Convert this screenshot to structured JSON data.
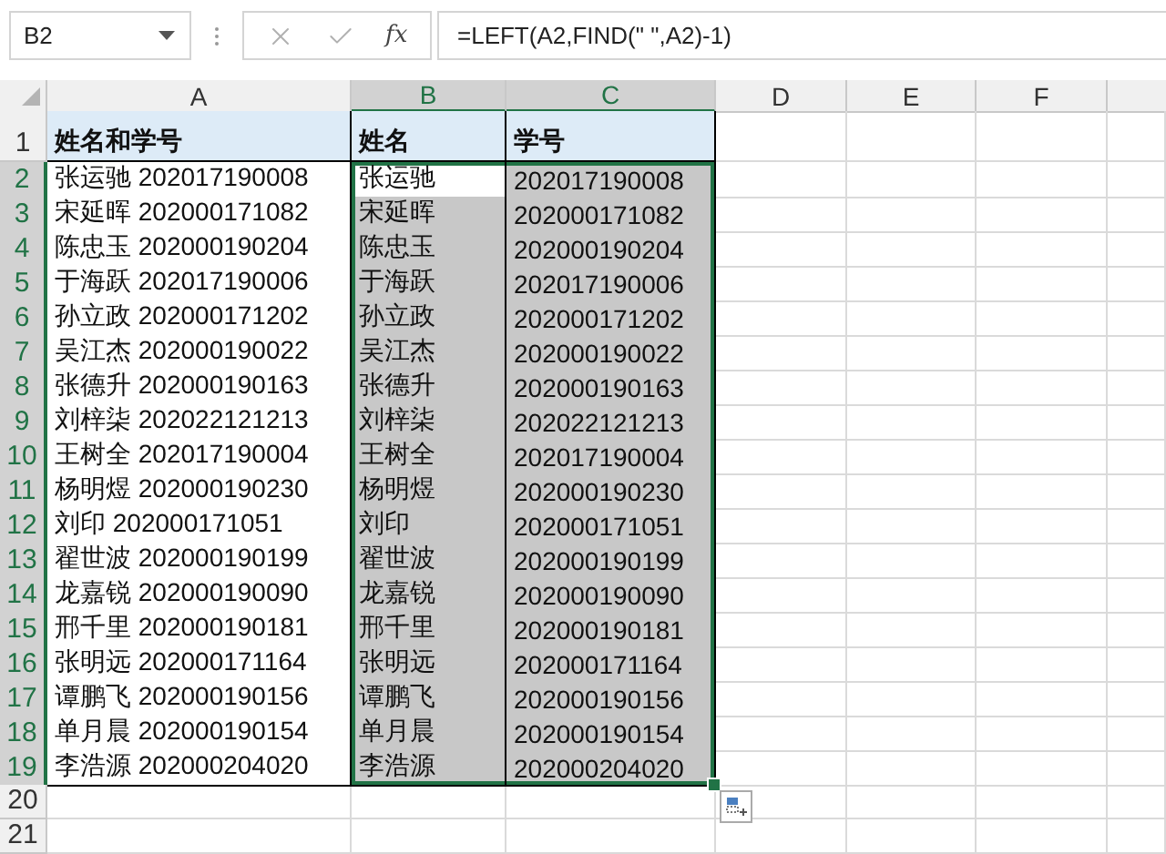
{
  "formula_bar": {
    "name_box": "B2",
    "fx": "fx",
    "formula": "=LEFT(A2,FIND(\" \",A2)-1)"
  },
  "columns": [
    {
      "label": "A",
      "selected": false
    },
    {
      "label": "B",
      "selected": true
    },
    {
      "label": "C",
      "selected": true
    },
    {
      "label": "D",
      "selected": false
    },
    {
      "label": "E",
      "selected": false
    },
    {
      "label": "F",
      "selected": false
    }
  ],
  "rows": [
    {
      "number": "1",
      "selected": false,
      "kind": "header",
      "cells": [
        {
          "text": "姓名和学号",
          "selected": false,
          "active": false
        },
        {
          "text": "姓名",
          "selected": false,
          "active": false
        },
        {
          "text": "学号",
          "selected": false,
          "active": false
        }
      ]
    },
    {
      "number": "2",
      "selected": true,
      "kind": "data",
      "cells": [
        {
          "text": "张运驰 202017190008",
          "selected": false,
          "active": false
        },
        {
          "text": "张运驰",
          "selected": true,
          "active": true
        },
        {
          "text": "202017190008",
          "selected": true,
          "active": false
        }
      ]
    },
    {
      "number": "3",
      "selected": true,
      "kind": "data",
      "cells": [
        {
          "text": "宋延晖 202000171082",
          "selected": false,
          "active": false
        },
        {
          "text": "宋延晖",
          "selected": true,
          "active": false
        },
        {
          "text": "202000171082",
          "selected": true,
          "active": false
        }
      ]
    },
    {
      "number": "4",
      "selected": true,
      "kind": "data",
      "cells": [
        {
          "text": "陈忠玉 202000190204",
          "selected": false,
          "active": false
        },
        {
          "text": "陈忠玉",
          "selected": true,
          "active": false
        },
        {
          "text": "202000190204",
          "selected": true,
          "active": false
        }
      ]
    },
    {
      "number": "5",
      "selected": true,
      "kind": "data",
      "cells": [
        {
          "text": "于海跃 202017190006",
          "selected": false,
          "active": false
        },
        {
          "text": "于海跃",
          "selected": true,
          "active": false
        },
        {
          "text": "202017190006",
          "selected": true,
          "active": false
        }
      ]
    },
    {
      "number": "6",
      "selected": true,
      "kind": "data",
      "cells": [
        {
          "text": "孙立政 202000171202",
          "selected": false,
          "active": false
        },
        {
          "text": "孙立政",
          "selected": true,
          "active": false
        },
        {
          "text": "202000171202",
          "selected": true,
          "active": false
        }
      ]
    },
    {
      "number": "7",
      "selected": true,
      "kind": "data",
      "cells": [
        {
          "text": "吴江杰 202000190022",
          "selected": false,
          "active": false
        },
        {
          "text": "吴江杰",
          "selected": true,
          "active": false
        },
        {
          "text": "202000190022",
          "selected": true,
          "active": false
        }
      ]
    },
    {
      "number": "8",
      "selected": true,
      "kind": "data",
      "cells": [
        {
          "text": "张德升 202000190163",
          "selected": false,
          "active": false
        },
        {
          "text": "张德升",
          "selected": true,
          "active": false
        },
        {
          "text": "202000190163",
          "selected": true,
          "active": false
        }
      ]
    },
    {
      "number": "9",
      "selected": true,
      "kind": "data",
      "cells": [
        {
          "text": "刘梓柒 202022121213",
          "selected": false,
          "active": false
        },
        {
          "text": "刘梓柒",
          "selected": true,
          "active": false
        },
        {
          "text": "202022121213",
          "selected": true,
          "active": false
        }
      ]
    },
    {
      "number": "10",
      "selected": true,
      "kind": "data",
      "cells": [
        {
          "text": "王树全 202017190004",
          "selected": false,
          "active": false
        },
        {
          "text": "王树全",
          "selected": true,
          "active": false
        },
        {
          "text": "202017190004",
          "selected": true,
          "active": false
        }
      ]
    },
    {
      "number": "11",
      "selected": true,
      "kind": "data",
      "cells": [
        {
          "text": "杨明煜 202000190230",
          "selected": false,
          "active": false
        },
        {
          "text": "杨明煜",
          "selected": true,
          "active": false
        },
        {
          "text": "202000190230",
          "selected": true,
          "active": false
        }
      ]
    },
    {
      "number": "12",
      "selected": true,
      "kind": "data",
      "cells": [
        {
          "text": "刘印 202000171051",
          "selected": false,
          "active": false
        },
        {
          "text": "刘印",
          "selected": true,
          "active": false
        },
        {
          "text": "202000171051",
          "selected": true,
          "active": false
        }
      ]
    },
    {
      "number": "13",
      "selected": true,
      "kind": "data",
      "cells": [
        {
          "text": "翟世波 202000190199",
          "selected": false,
          "active": false
        },
        {
          "text": "翟世波",
          "selected": true,
          "active": false
        },
        {
          "text": "202000190199",
          "selected": true,
          "active": false
        }
      ]
    },
    {
      "number": "14",
      "selected": true,
      "kind": "data",
      "cells": [
        {
          "text": "龙嘉锐 202000190090",
          "selected": false,
          "active": false
        },
        {
          "text": "龙嘉锐",
          "selected": true,
          "active": false
        },
        {
          "text": "202000190090",
          "selected": true,
          "active": false
        }
      ]
    },
    {
      "number": "15",
      "selected": true,
      "kind": "data",
      "cells": [
        {
          "text": "邢千里 202000190181",
          "selected": false,
          "active": false
        },
        {
          "text": "邢千里",
          "selected": true,
          "active": false
        },
        {
          "text": "202000190181",
          "selected": true,
          "active": false
        }
      ]
    },
    {
      "number": "16",
      "selected": true,
      "kind": "data",
      "cells": [
        {
          "text": "张明远 202000171164",
          "selected": false,
          "active": false
        },
        {
          "text": "张明远",
          "selected": true,
          "active": false
        },
        {
          "text": "202000171164",
          "selected": true,
          "active": false
        }
      ]
    },
    {
      "number": "17",
      "selected": true,
      "kind": "data",
      "cells": [
        {
          "text": "谭鹏飞 202000190156",
          "selected": false,
          "active": false
        },
        {
          "text": "谭鹏飞",
          "selected": true,
          "active": false
        },
        {
          "text": "202000190156",
          "selected": true,
          "active": false
        }
      ]
    },
    {
      "number": "18",
      "selected": true,
      "kind": "data",
      "cells": [
        {
          "text": "单月晨 202000190154",
          "selected": false,
          "active": false
        },
        {
          "text": "单月晨",
          "selected": true,
          "active": false
        },
        {
          "text": "202000190154",
          "selected": true,
          "active": false
        }
      ]
    },
    {
      "number": "19",
      "selected": true,
      "kind": "data",
      "cells": [
        {
          "text": "李浩源 202000204020",
          "selected": false,
          "active": false
        },
        {
          "text": "李浩源",
          "selected": true,
          "active": false
        },
        {
          "text": "202000204020",
          "selected": true,
          "active": false
        }
      ]
    },
    {
      "number": "20",
      "selected": false,
      "kind": "data"
    },
    {
      "number": "21",
      "selected": false,
      "kind": "data"
    }
  ]
}
